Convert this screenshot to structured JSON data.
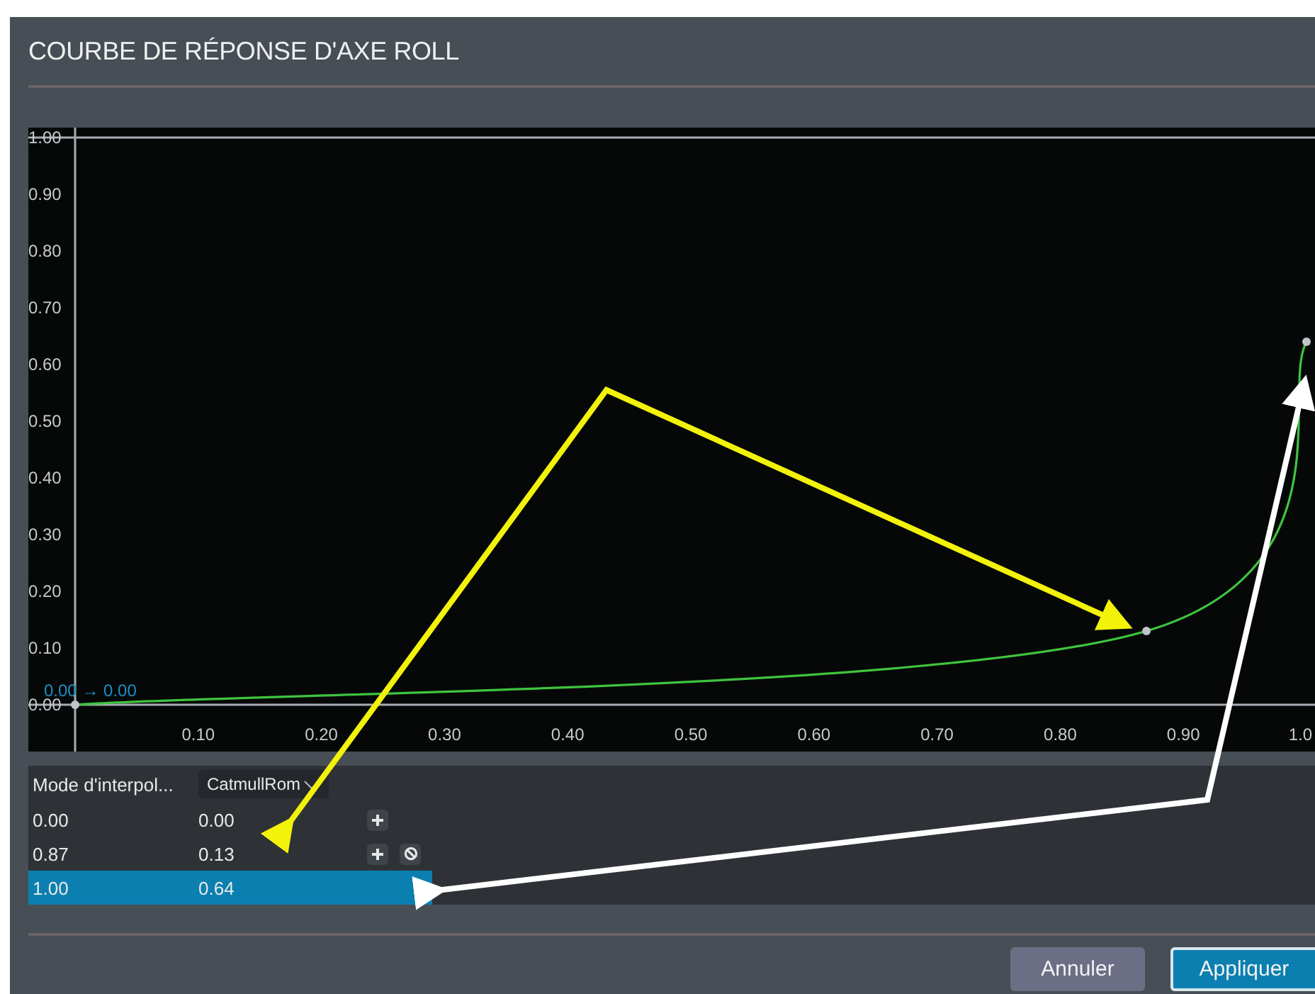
{
  "window": {
    "title": "COURBE DE RÉPONSE D'AXE ROLL"
  },
  "chart": {
    "chart_data": {
      "type": "line",
      "x": [
        0,
        0.87,
        1.0
      ],
      "series": [
        {
          "color": "#3fc43f",
          "marker": "circle",
          "values": [
            0,
            0.13,
            0.64
          ]
        }
      ],
      "xlim": [
        0,
        1
      ],
      "ylim": [
        0,
        1
      ],
      "xticks": [
        {
          "value": 0.1,
          "label": "0.10"
        },
        {
          "value": 0.2,
          "label": "0.20"
        },
        {
          "value": 0.3,
          "label": "0.30"
        },
        {
          "value": 0.4,
          "label": "0.40"
        },
        {
          "value": 0.5,
          "label": "0.50"
        },
        {
          "value": 0.6,
          "label": "0.60"
        },
        {
          "value": 0.7,
          "label": "0.70"
        },
        {
          "value": 0.8,
          "label": "0.80"
        },
        {
          "value": 0.9,
          "label": "0.90"
        },
        {
          "value": 1.0,
          "label": "1.0"
        }
      ],
      "yticks": [
        {
          "value": 0,
          "label": "0.00"
        },
        {
          "value": 0.1,
          "label": "0.10"
        },
        {
          "value": 0.2,
          "label": "0.20"
        },
        {
          "value": 0.3,
          "label": "0.30"
        },
        {
          "value": 0.4,
          "label": "0.40"
        },
        {
          "value": 0.5,
          "label": "0.50"
        },
        {
          "value": 0.6,
          "label": "0.60"
        },
        {
          "value": 0.7,
          "label": "0.70"
        },
        {
          "value": 0.8,
          "label": "0.80"
        },
        {
          "value": 0.9,
          "label": "0.90"
        },
        {
          "value": 1.0,
          "label": "1.00"
        }
      ],
      "annotations": [
        {
          "x": 0,
          "y": 0,
          "text": "0.00 → 0.00"
        }
      ]
    }
  },
  "table": {
    "header": {
      "label": "Mode d'interpol...",
      "dropdown": "CatmullRom"
    },
    "rows": [
      {
        "input": "0.00",
        "output": "0.00",
        "selected": false,
        "actions": [
          {
            "kind": "add"
          }
        ]
      },
      {
        "input": "0.87",
        "output": "0.13",
        "selected": false,
        "actions": [
          {
            "kind": "add"
          },
          {
            "kind": "delete"
          }
        ]
      },
      {
        "input": "1.00",
        "output": "0.64",
        "selected": true,
        "actions": []
      }
    ]
  },
  "buttons": [
    {
      "label": "Annuler",
      "kind": "secondary"
    },
    {
      "label": "Appliquer",
      "kind": "primary"
    }
  ]
}
